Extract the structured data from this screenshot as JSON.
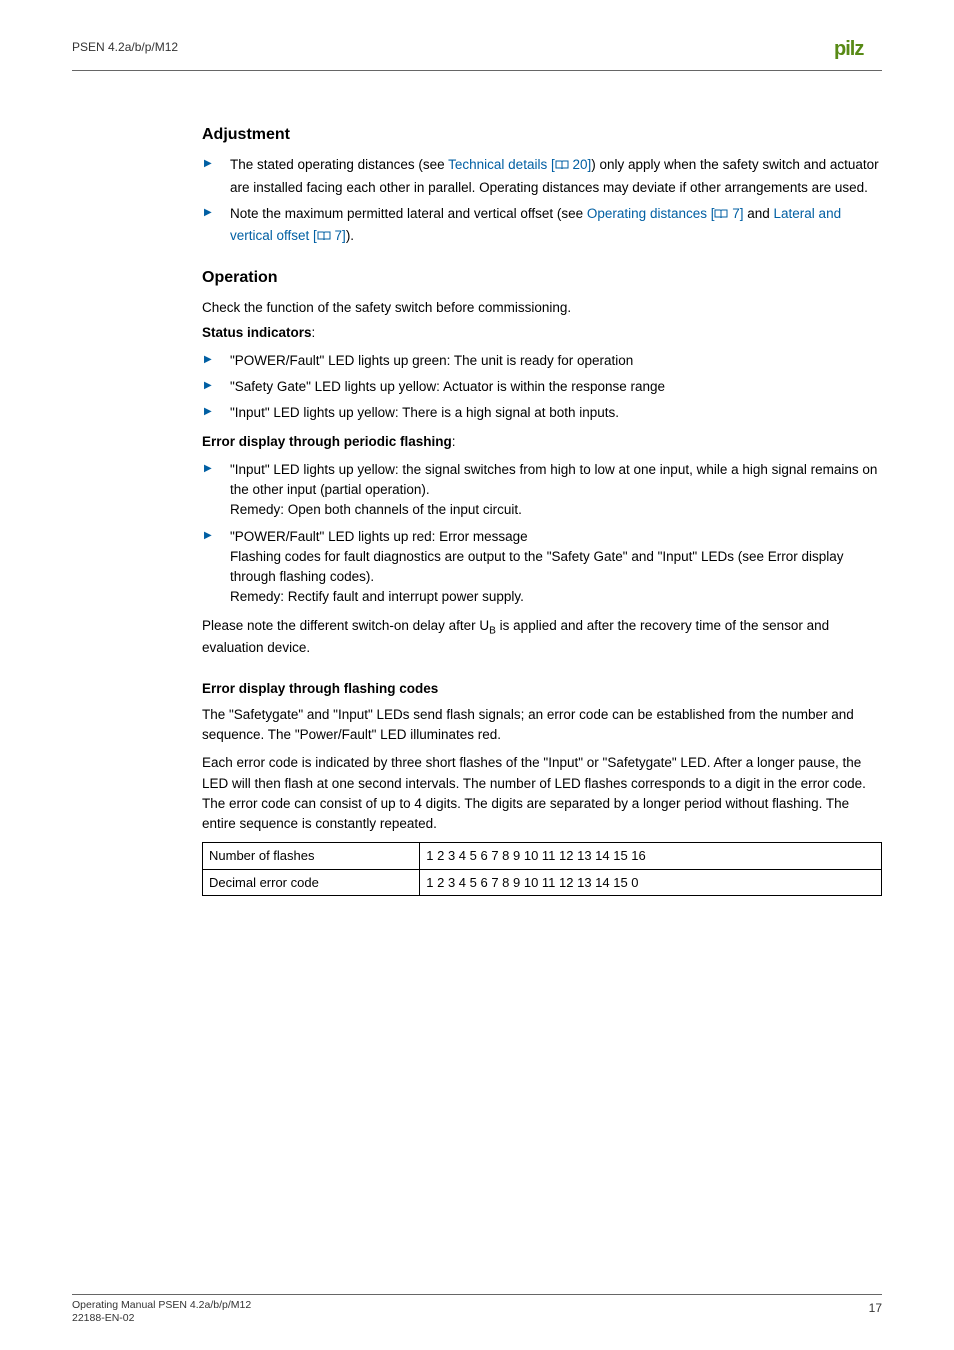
{
  "header": {
    "product": "PSEN 4.2a/b/p/M12",
    "brand": "pilz"
  },
  "sections": {
    "adjustment": {
      "title": "Adjustment",
      "bullets": [
        {
          "pre": "The stated operating distances (see ",
          "link": "Technical details [",
          "ref": " 20]",
          "post": ") only apply when the safety switch and actuator are installed facing each other in parallel. Operating distances may deviate if other arrangements are used."
        },
        {
          "pre": "Note the maximum permitted lateral and vertical offset (see ",
          "link1": "Operating distances [",
          "ref1": " 7]",
          "mid": " and ",
          "link2": "Lateral and vertical offset [",
          "ref2": " 7]",
          "post": ")."
        }
      ]
    },
    "operation": {
      "title": "Operation",
      "intro": "Check the function of the safety switch before commissioning.",
      "status_label": "Status indicators",
      "status_colon": ":",
      "status_items": [
        "\"POWER/Fault\" LED lights up green: The unit is ready for operation",
        "\"Safety Gate\" LED lights up yellow: Actuator is within the response range",
        "\"Input\" LED lights up yellow: There is a high signal at both inputs."
      ],
      "error_flash_label": "Error display through periodic flashing",
      "error_flash_colon": ":",
      "error_flash_items": [
        "\"Input\" LED lights up yellow: the signal switches from high to low at one input, while a high signal remains on the other input (partial operation).\nRemedy: Open both channels of the input circuit.",
        "\"POWER/Fault\" LED lights up red: Error message\nFlashing codes for fault diagnostics are output to the \"Safety Gate\" and \"Input\" LEDs (see Error display through flashing codes).\nRemedy: Rectify fault and interrupt power supply."
      ],
      "note_pre": "Please note the different switch-on delay after U",
      "note_sub": "B",
      "note_post": " is applied and after the recovery time of the sensor and evaluation device.",
      "flash_codes": {
        "heading": "Error display through flashing codes",
        "p1": "The \"Safetygate\" and \"Input\" LEDs send flash signals; an error code can be established from the number and sequence. The \"Power/Fault\" LED illuminates red.",
        "p2": "Each error code is indicated by three short flashes of the \"Input\" or \"Safetygate\" LED. After a longer pause, the LED will then flash at one second intervals. The number of LED flashes corresponds to a digit in the error code. The error code can consist of up to 4 digits. The digits are separated by a longer period without flashing. The entire sequence is constantly repeated.",
        "table": {
          "rows": [
            {
              "label": "Number of flashes",
              "value": "1 2 3 4 5 6 7 8 9 10 11 12 13 14 15 16"
            },
            {
              "label": "Decimal error code",
              "value": "1 2 3 4 5 6 7 8 9 10 11 12 13 14 15 0"
            }
          ]
        }
      }
    }
  },
  "footer": {
    "line1": "Operating Manual PSEN 4.2a/b/p/M12",
    "line2": "22188-EN-02",
    "page": "17"
  }
}
